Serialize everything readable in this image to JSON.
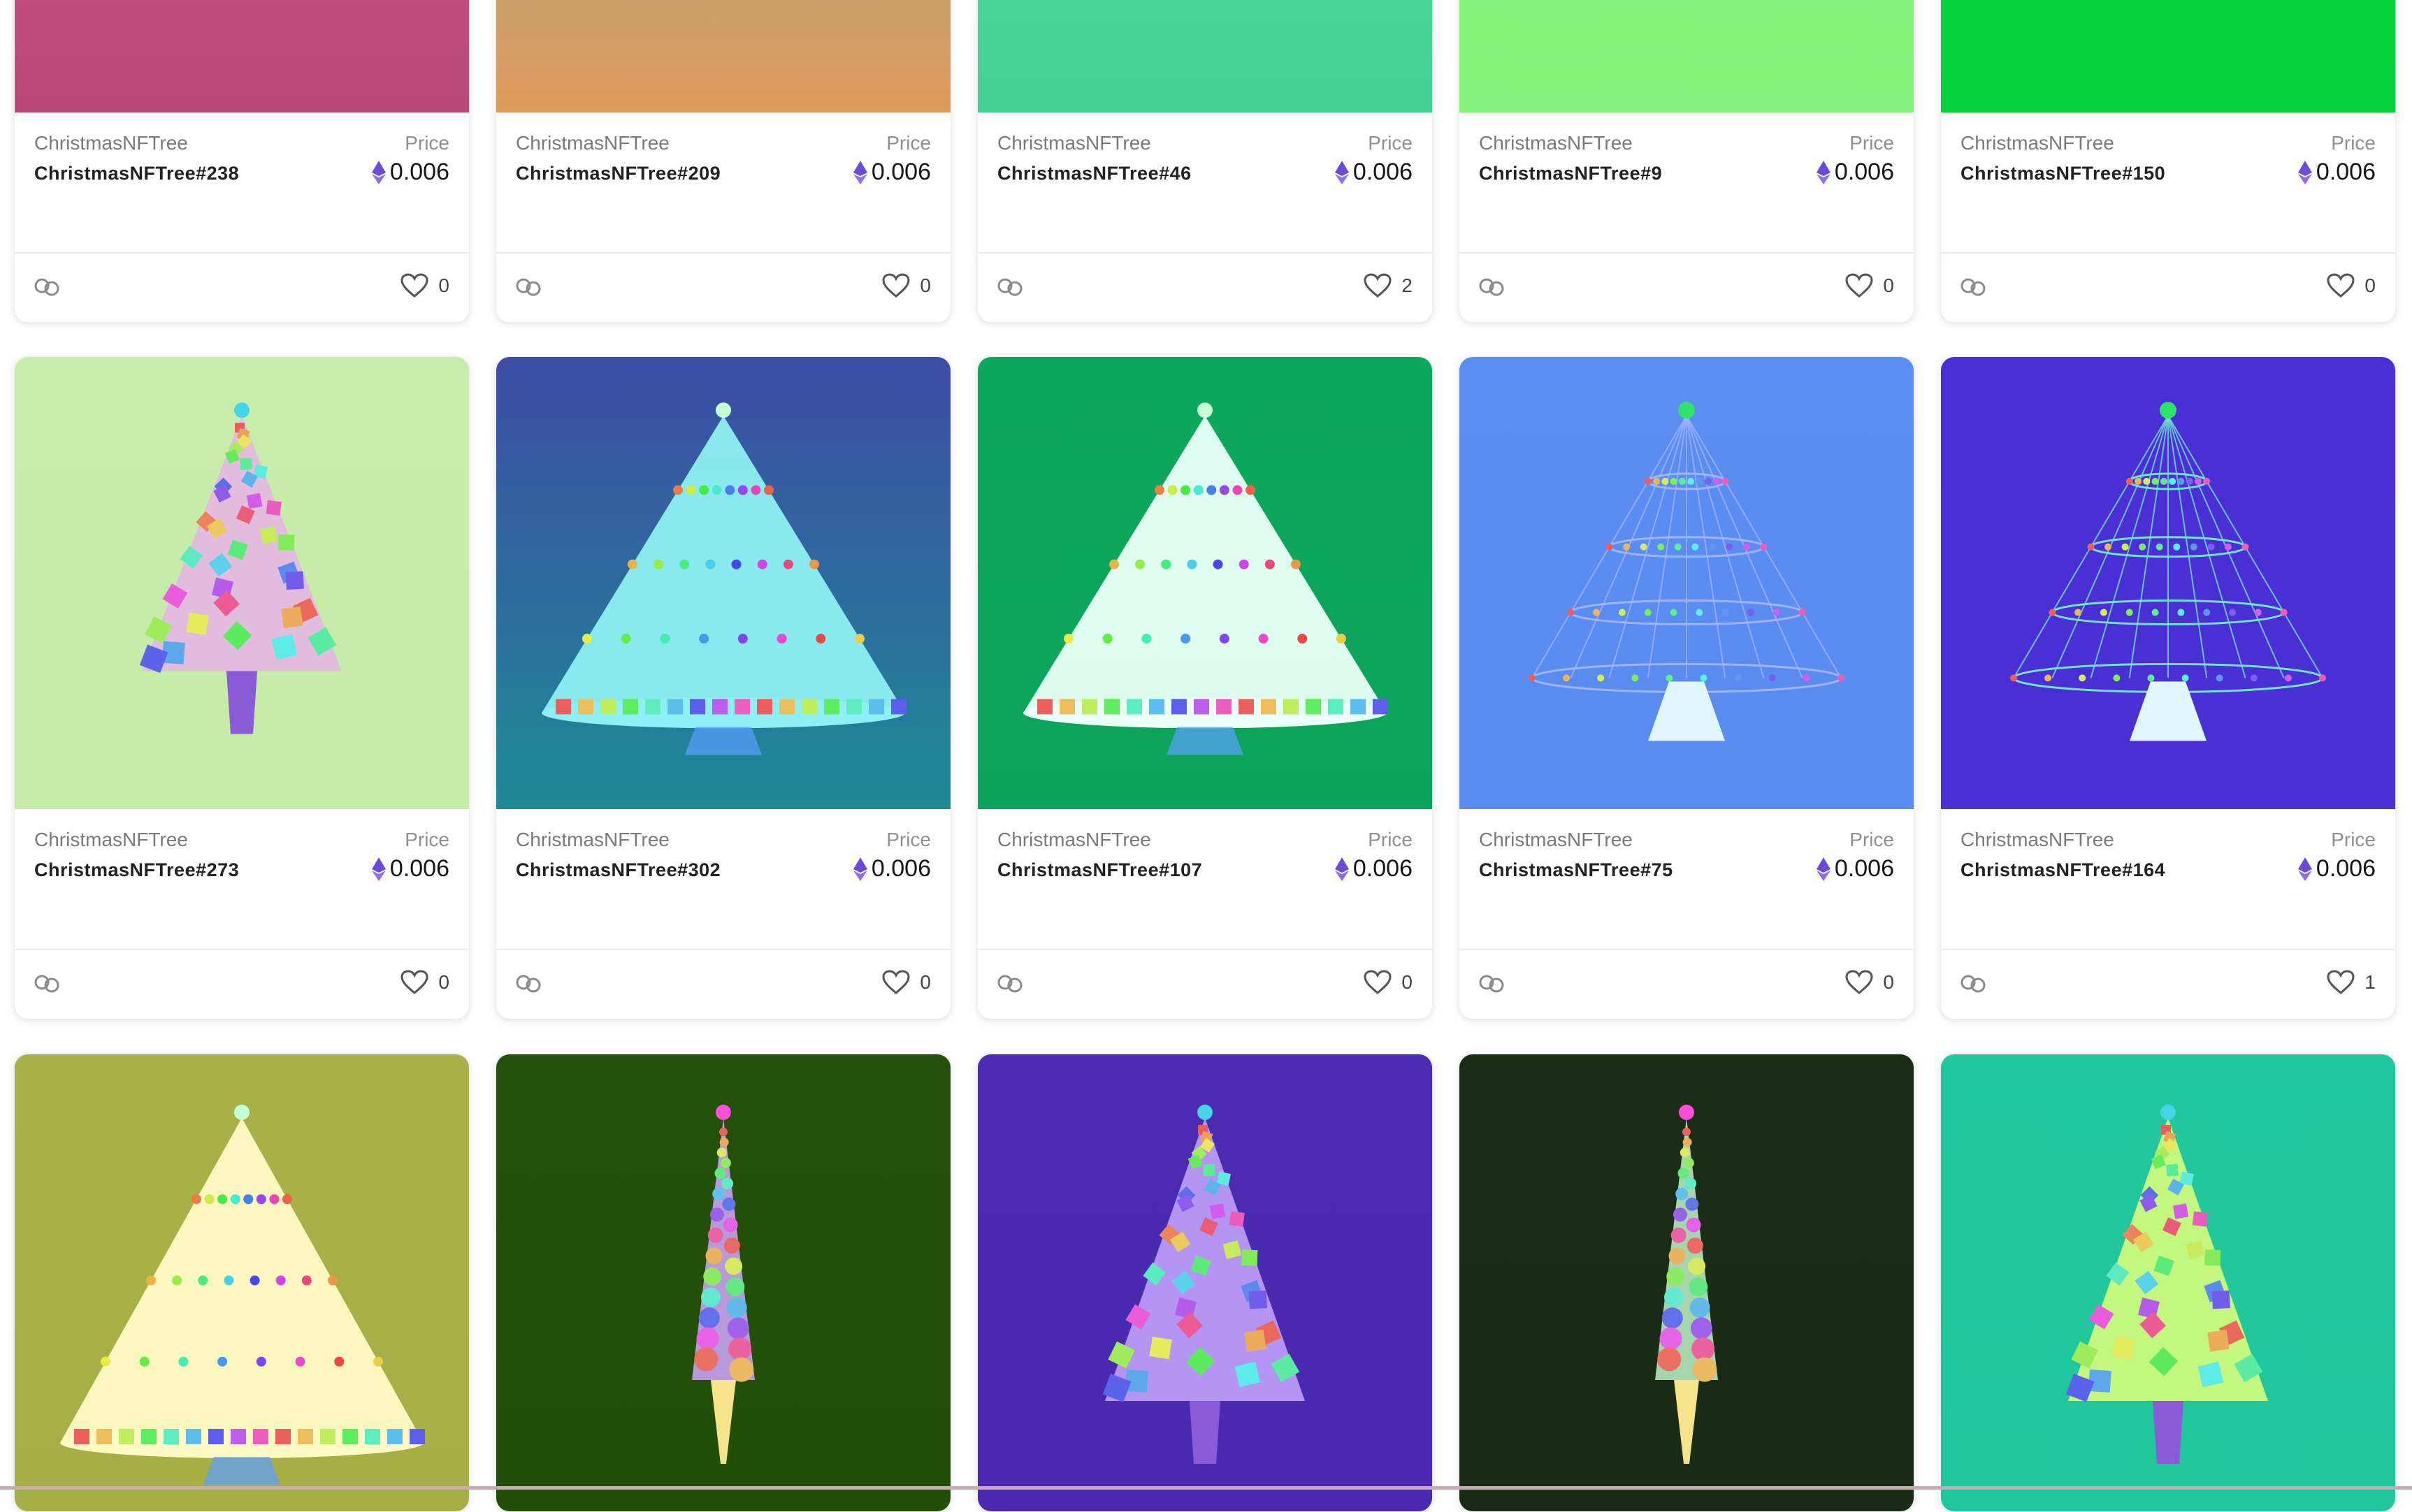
{
  "price_label": "Price",
  "cards": [
    {
      "collection": "ChristmasNFTree",
      "name": "ChristmasNFTree#238",
      "price": "0.006",
      "likes": "0",
      "bg": "#c44c7e",
      "bg2": "#b94b78",
      "tree": "none"
    },
    {
      "collection": "ChristmasNFTree",
      "name": "ChristmasNFTree#209",
      "price": "0.006",
      "likes": "0",
      "bg": "#c7a26e",
      "bg2": "#e09a5a",
      "tree": "none"
    },
    {
      "collection": "ChristmasNFTree",
      "name": "ChristmasNFTree#46",
      "price": "0.006",
      "likes": "2",
      "bg": "#4fd698",
      "bg2": "#45cf92",
      "tree": "none"
    },
    {
      "collection": "ChristmasNFTree",
      "name": "ChristmasNFTree#9",
      "price": "0.006",
      "likes": "0",
      "bg": "#86f57a",
      "bg2": "#84f278",
      "tree": "none"
    },
    {
      "collection": "ChristmasNFTree",
      "name": "ChristmasNFTree#150",
      "price": "0.006",
      "likes": "0",
      "bg": "#06d43a",
      "bg2": "#05d138",
      "tree": "none"
    },
    {
      "collection": "ChristmasNFTree",
      "name": "ChristmasNFTree#273",
      "price": "0.006",
      "likes": "0",
      "bg": "#c8edaa",
      "bg2": "#c6eca8",
      "tree": "spiral",
      "tcolor": "#e6b4e8"
    },
    {
      "collection": "ChristmasNFTree",
      "name": "ChristmasNFTree#302",
      "price": "0.006",
      "likes": "0",
      "bg": "#3d4ca5",
      "bg2": "#1e8a96",
      "tree": "cone",
      "tcolor": "#8ef0f2"
    },
    {
      "collection": "ChristmasNFTree",
      "name": "ChristmasNFTree#107",
      "price": "0.006",
      "likes": "0",
      "bg": "#0ea85c",
      "bg2": "#0ba35a",
      "tree": "cone",
      "tcolor": "#e9fff8"
    },
    {
      "collection": "ChristmasNFTree",
      "name": "ChristmasNFTree#75",
      "price": "0.006",
      "likes": "0",
      "bg": "#5b8df2",
      "bg2": "#5a8bf0",
      "tree": "wire",
      "tcolor": "#9fb4ff"
    },
    {
      "collection": "ChristmasNFTree",
      "name": "ChristmasNFTree#164",
      "price": "0.006",
      "likes": "1",
      "bg": "#4a2fd6",
      "bg2": "#4a2fd4",
      "tree": "wire",
      "tcolor": "#6fe3d0"
    },
    {
      "collection": "",
      "name": "",
      "price": "",
      "likes": "",
      "bg": "#a9b14a",
      "bg2": "#a6ae46",
      "tree": "cone",
      "tcolor": "#fffac4"
    },
    {
      "collection": "",
      "name": "",
      "price": "",
      "likes": "",
      "bg": "#245009",
      "bg2": "#234e08",
      "tree": "slim",
      "tcolor": "#d2a6ff"
    },
    {
      "collection": "",
      "name": "",
      "price": "",
      "likes": "",
      "bg": "#4b2bb2",
      "bg2": "#4a2ab0",
      "tree": "spiral",
      "tcolor": "#c8a8ff"
    },
    {
      "collection": "",
      "name": "",
      "price": "",
      "likes": "",
      "bg": "#1b2d17",
      "bg2": "#1a2c16",
      "tree": "slim",
      "tcolor": "#bff2c7"
    },
    {
      "collection": "",
      "name": "",
      "price": "",
      "likes": "",
      "bg": "#22c89d",
      "bg2": "#21c69b",
      "tree": "spiral",
      "tcolor": "#e0ff7a"
    }
  ]
}
